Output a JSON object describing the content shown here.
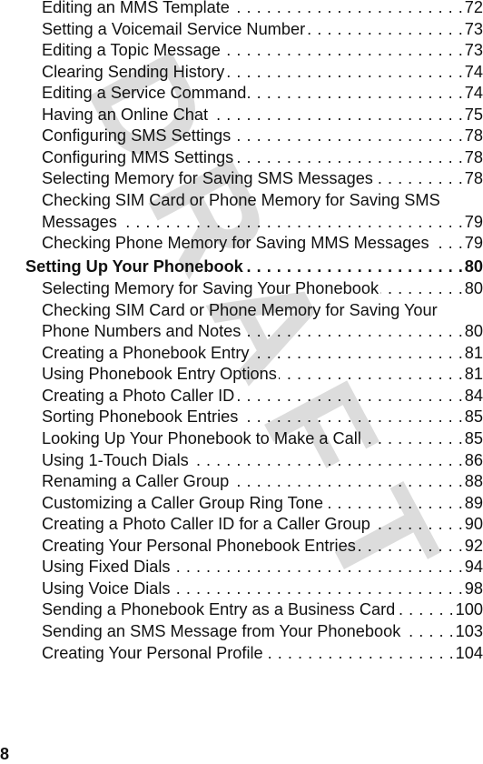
{
  "page_number": "8",
  "watermark": "DRAFT",
  "toc": [
    {
      "type": "item",
      "title": "Editing an MMS Template",
      "page": "72"
    },
    {
      "type": "item",
      "title": "Setting a Voicemail Service Number",
      "page": "73"
    },
    {
      "type": "item",
      "title": "Editing a Topic Message",
      "page": "73"
    },
    {
      "type": "item",
      "title": "Clearing Sending History",
      "page": "74"
    },
    {
      "type": "item",
      "title": "Editing a Service Command",
      "page": "74"
    },
    {
      "type": "item",
      "title": "Having an Online Chat",
      "page": "75"
    },
    {
      "type": "item",
      "title": "Configuring SMS Settings",
      "page": "78"
    },
    {
      "type": "item",
      "title": "Configuring MMS Settings",
      "page": "78"
    },
    {
      "type": "item",
      "title": "Selecting Memory for Saving SMS Messages",
      "page": "78"
    },
    {
      "type": "cont",
      "title": "Checking SIM Card or Phone Memory for Saving SMS"
    },
    {
      "type": "item",
      "title": "Messages",
      "page": "79"
    },
    {
      "type": "item",
      "title": "Checking Phone Memory for Saving MMS Messages",
      "page": "79"
    },
    {
      "type": "heading",
      "title": "Setting Up Your Phonebook",
      "page": "80"
    },
    {
      "type": "item",
      "title": "Selecting Memory for Saving Your Phonebook",
      "page": "80"
    },
    {
      "type": "cont",
      "title": "Checking SIM Card or Phone Memory for Saving Your"
    },
    {
      "type": "item",
      "title": "Phone Numbers and Notes",
      "page": "80"
    },
    {
      "type": "item",
      "title": "Creating a Phonebook Entry",
      "page": "81"
    },
    {
      "type": "item",
      "title": "Using Phonebook Entry Options",
      "page": "81"
    },
    {
      "type": "item",
      "title": "Creating a Photo Caller ID",
      "page": "84"
    },
    {
      "type": "item",
      "title": "Sorting Phonebook Entries",
      "page": "85"
    },
    {
      "type": "item",
      "title": "Looking Up Your Phonebook to Make a Call",
      "page": "85"
    },
    {
      "type": "item",
      "title": "Using 1-Touch Dials",
      "page": "86"
    },
    {
      "type": "item",
      "title": "Renaming a Caller Group",
      "page": "88"
    },
    {
      "type": "item",
      "title": "Customizing a Caller Group Ring Tone",
      "page": "89"
    },
    {
      "type": "item",
      "title": "Creating a Photo Caller ID for a Caller Group",
      "page": "90"
    },
    {
      "type": "item",
      "title": "Creating Your Personal Phonebook Entries",
      "page": "92"
    },
    {
      "type": "item",
      "title": "Using Fixed Dials",
      "page": "94"
    },
    {
      "type": "item",
      "title": "Using Voice Dials",
      "page": "98"
    },
    {
      "type": "item",
      "title": "Sending a Phonebook Entry as a Business Card",
      "page": "100"
    },
    {
      "type": "item",
      "title": "Sending an SMS Message from Your Phonebook",
      "page": "103"
    },
    {
      "type": "item",
      "title": "Creating Your Personal Profile",
      "page": "104"
    }
  ]
}
